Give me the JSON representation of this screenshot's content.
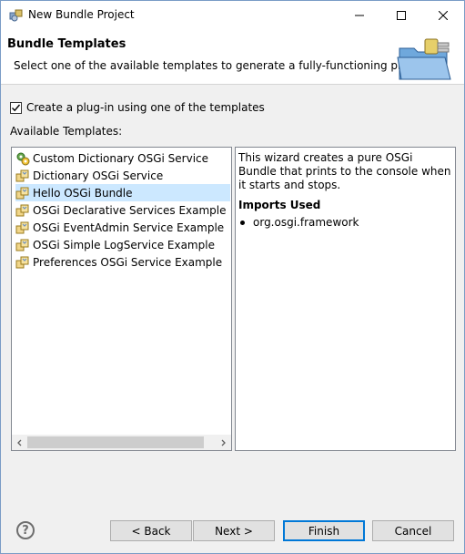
{
  "window": {
    "title": "New Bundle Project"
  },
  "banner": {
    "heading": "Bundle Templates",
    "description": "Select one of the available templates to generate a fully-functioning plug-in."
  },
  "options": {
    "use_template_label": "Create a plug-in using one of the templates",
    "use_template_checked": true,
    "available_templates_label": "Available Templates:"
  },
  "templates": [
    {
      "label": "Custom Dictionary OSGi Service",
      "icon": "osgi-gear-icon",
      "selected": false
    },
    {
      "label": "Dictionary OSGi Service",
      "icon": "osgi-plugin-icon",
      "selected": false
    },
    {
      "label": "Hello OSGi Bundle",
      "icon": "osgi-plugin-icon",
      "selected": true
    },
    {
      "label": "OSGi Declarative Services Example",
      "icon": "osgi-plugin-icon",
      "selected": false
    },
    {
      "label": "OSGi EventAdmin Service Example",
      "icon": "osgi-plugin-icon",
      "selected": false
    },
    {
      "label": "OSGi Simple LogService Example",
      "icon": "osgi-plugin-icon",
      "selected": false
    },
    {
      "label": "Preferences OSGi Service Example",
      "icon": "osgi-plugin-icon",
      "selected": false
    }
  ],
  "details": {
    "description": "This wizard creates a pure OSGi Bundle that prints to the console when it starts and stops.",
    "imports_heading": "Imports Used",
    "imports": [
      "org.osgi.framework"
    ]
  },
  "buttons": {
    "help": "?",
    "back": "< Back",
    "next": "Next >",
    "finish": "Finish",
    "cancel": "Cancel"
  },
  "colors": {
    "selection": "#cce8ff",
    "default_button_border": "#0078d7"
  }
}
